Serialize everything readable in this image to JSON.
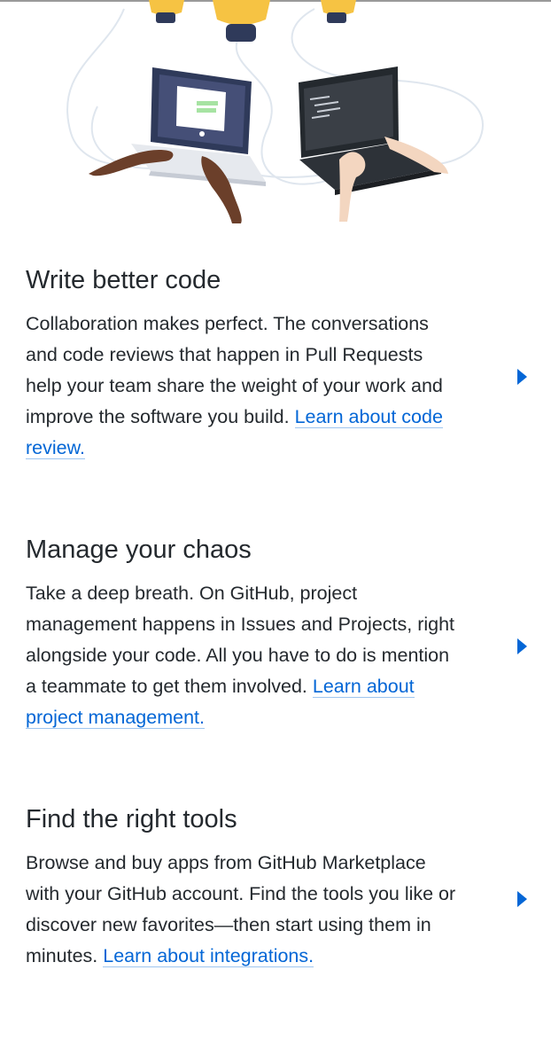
{
  "sections": [
    {
      "title": "Write better code",
      "body": "Collaboration makes perfect. The conversations and code reviews that happen in Pull Requests help your team share the weight of your work and improve the software you build.",
      "link": "Learn about code review."
    },
    {
      "title": "Manage your chaos",
      "body": "Take a deep breath. On GitHub, project management happens in Issues and Projects, right alongside your code. All you have to do is mention a teammate to get them involved.",
      "link": "Learn about project management."
    },
    {
      "title": "Find the right tools",
      "body": "Browse and buy apps from GitHub Marketplace with your GitHub account. Find the tools you like or discover new favorites—then start using them in minutes.",
      "link": "Learn about integrations."
    }
  ],
  "icons": {
    "hero": "laptops-collaboration-illustration",
    "arrow": "chevron-right-icon"
  },
  "colors": {
    "link": "#0366d6",
    "text": "#24292e",
    "background": "#ffffff"
  }
}
